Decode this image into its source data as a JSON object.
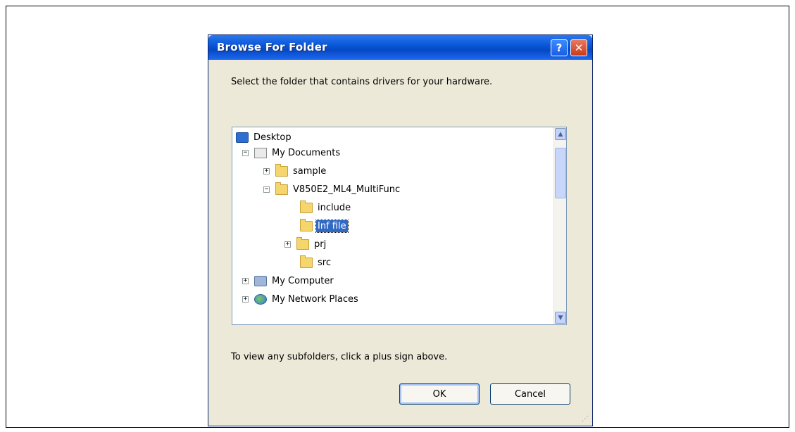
{
  "dialog": {
    "title": "Browse For Folder",
    "help_label": "?",
    "close_label": "✕",
    "instruction": "Select the folder that contains drivers for your hardware.",
    "hint": "To view any subfolders, click a plus sign above.",
    "ok_label": "OK",
    "cancel_label": "Cancel"
  },
  "tree": {
    "items": [
      {
        "label": "Desktop",
        "expander": "",
        "icon": "desktop-icon"
      },
      {
        "label": "My Documents",
        "expander": "−",
        "icon": "my-documents-icon"
      },
      {
        "label": "sample",
        "expander": "+",
        "icon": "folder-icon"
      },
      {
        "label": "V850E2_ML4_MultiFunc",
        "expander": "−",
        "icon": "folder-icon"
      },
      {
        "label": "include",
        "expander": "",
        "icon": "folder-icon"
      },
      {
        "label": "Inf file",
        "expander": "",
        "icon": "folder-icon",
        "selected": true
      },
      {
        "label": "prj",
        "expander": "+",
        "icon": "folder-icon"
      },
      {
        "label": "src",
        "expander": "",
        "icon": "folder-icon"
      },
      {
        "label": "My Computer",
        "expander": "+",
        "icon": "computer-icon"
      },
      {
        "label": "My Network Places",
        "expander": "+",
        "icon": "network-icon"
      }
    ]
  },
  "scrollbar": {
    "up_label": "▲",
    "down_label": "▼"
  }
}
